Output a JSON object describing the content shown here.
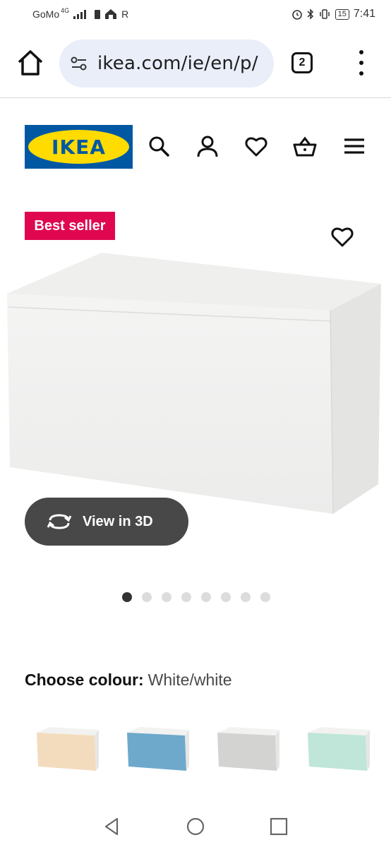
{
  "status_bar": {
    "carrier": "GoMo",
    "network": "4G",
    "roaming": "R",
    "battery": "15",
    "time": "7:41"
  },
  "browser": {
    "url": "ikea.com/ie/en/p/",
    "tab_count": "2"
  },
  "header": {
    "logo_text": "IKEA",
    "icons": [
      "search-icon",
      "account-icon",
      "favourites-icon",
      "basket-icon",
      "menu-icon"
    ]
  },
  "product": {
    "badge": "Best seller",
    "view_3d_label": "View in 3D",
    "image_count": 8,
    "active_image_index": 0
  },
  "colour": {
    "label": "Choose colour:",
    "value": "White/white",
    "swatches": [
      {
        "front": "#f3dcbd",
        "body": "#f2f2f0"
      },
      {
        "front": "#6ea9cc",
        "body": "#f2f2f0"
      },
      {
        "front": "#d3d3d2",
        "body": "#f2f2f0"
      },
      {
        "front": "#bfe6d8",
        "body": "#f2f2f0"
      }
    ]
  },
  "colors": {
    "ikea_blue": "#0058a3",
    "ikea_yellow": "#ffdb00",
    "badge_red": "#e00751",
    "button_dark": "#484848"
  }
}
